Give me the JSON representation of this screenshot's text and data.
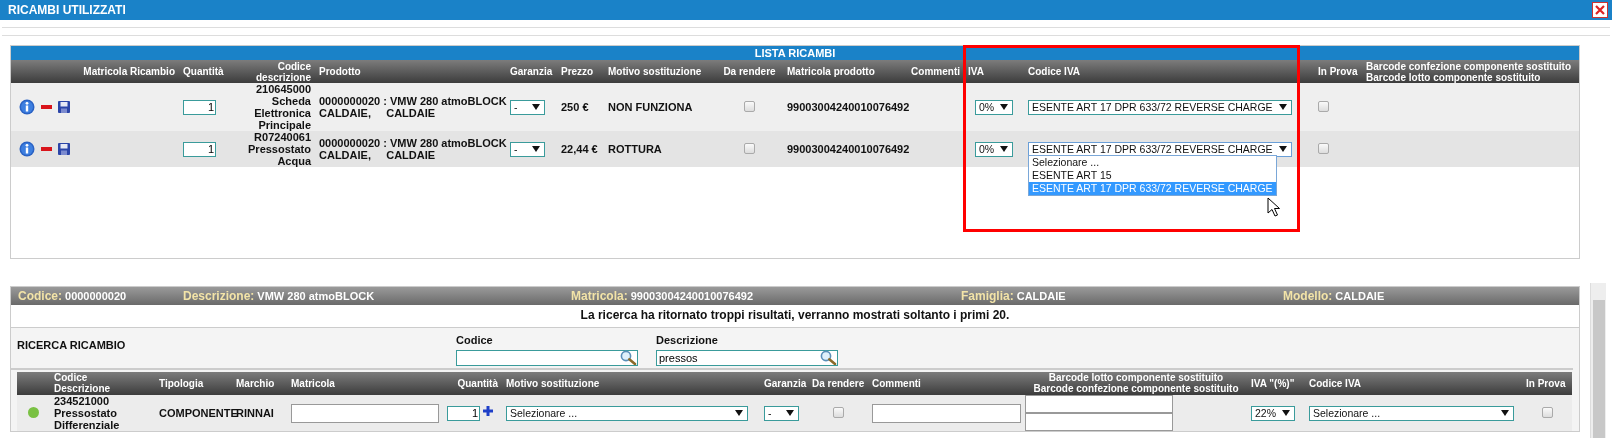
{
  "window": {
    "title": "RICAMBI UTILIZZATI"
  },
  "parts_list": {
    "title": "LISTA RICAMBI",
    "columns": [
      "Matricola Ricambio",
      "Quantità",
      "Codice descrizione",
      "Prodotto",
      "Garanzia",
      "Prezzo",
      "Motivo sostituzione",
      "Da rendere",
      "Matricola prodotto",
      "Commenti",
      "IVA",
      "Codice IVA",
      "In Prova",
      "Barcode confezione componente sostituito\nBarcode lotto componente sostituito"
    ],
    "rows": [
      {
        "quantity": "1",
        "code_description": "210645000 Scheda Elettronica Principale",
        "product": "0000000020 : VMW 280 atmoBLOCK\nCALDAIE,     CALDAIE",
        "warranty": "-",
        "price": "250 €",
        "reason": "NON FUNZIONA",
        "to_return": false,
        "product_serial": "99003004240010076492",
        "vat": "0%",
        "vat_code": "ESENTE ART 17 DPR 633/72 REVERSE CHARGE",
        "vat_code_open": false,
        "on_trial": false
      },
      {
        "quantity": "1",
        "code_description": "R07240061 Pressostato Acqua",
        "product": "0000000020 : VMW 280 atmoBLOCK\nCALDAIE,     CALDAIE",
        "warranty": "-",
        "price": "22,44 €",
        "reason": "ROTTURA",
        "to_return": false,
        "product_serial": "99003004240010076492",
        "vat": "0%",
        "vat_code": "ESENTE ART 17 DPR 633/72 REVERSE CHARGE",
        "vat_code_open": true,
        "vat_code_options": [
          {
            "label": "Selezionare ...",
            "selected": false
          },
          {
            "label": "ESENTE ART 15",
            "selected": false
          },
          {
            "label": "ESENTE ART 17 DPR 633/72 REVERSE CHARGE",
            "selected": true
          }
        ],
        "on_trial": false
      }
    ]
  },
  "annotations": [
    {
      "kind": "rectangle"
    }
  ],
  "spare_part": {
    "fields": [
      {
        "label": "Codice:",
        "value": "0000000020"
      },
      {
        "label": "Descrizione:",
        "value": "VMW 280 atmoBLOCK"
      },
      {
        "label": "Matricola:",
        "value": "99003004240010076492"
      },
      {
        "label": "Famiglia:",
        "value": "CALDAIE"
      },
      {
        "label": "Modello:",
        "value": "CALDAIE"
      }
    ]
  },
  "message": "La ricerca ha ritornato troppi risultati, verranno mostrati soltanto i primi 20.",
  "search": {
    "title": "RICERCA RICAMBIO",
    "fields": [
      {
        "label": "Codice"
      },
      {
        "label": "Descrizione",
        "value": "pressos"
      }
    ]
  },
  "results": {
    "columns": [
      "Codice\nDescrizione",
      "Tipologia",
      "Marchio",
      "Matricola",
      "Quantità",
      "Motivo sostituzione",
      "Garanzia",
      "Da rendere",
      "Commenti",
      "Barcode lotto componente sostituito\nBarcode confezione componente sostituito",
      "IVA \"(%)\"",
      "Codice IVA",
      "In Prova"
    ],
    "rows": [
      {
        "color": "#7ac143",
        "code_description": "234521000 Pressostato Differenziale",
        "type": "COMPONENTE",
        "brand": "RINNAI",
        "quantity": "1",
        "reason": "Selezionare ...",
        "warranty": "-",
        "to_return": false,
        "vat": "22%",
        "vat_code": "Selezionare ...",
        "on_trial": false
      }
    ]
  }
}
